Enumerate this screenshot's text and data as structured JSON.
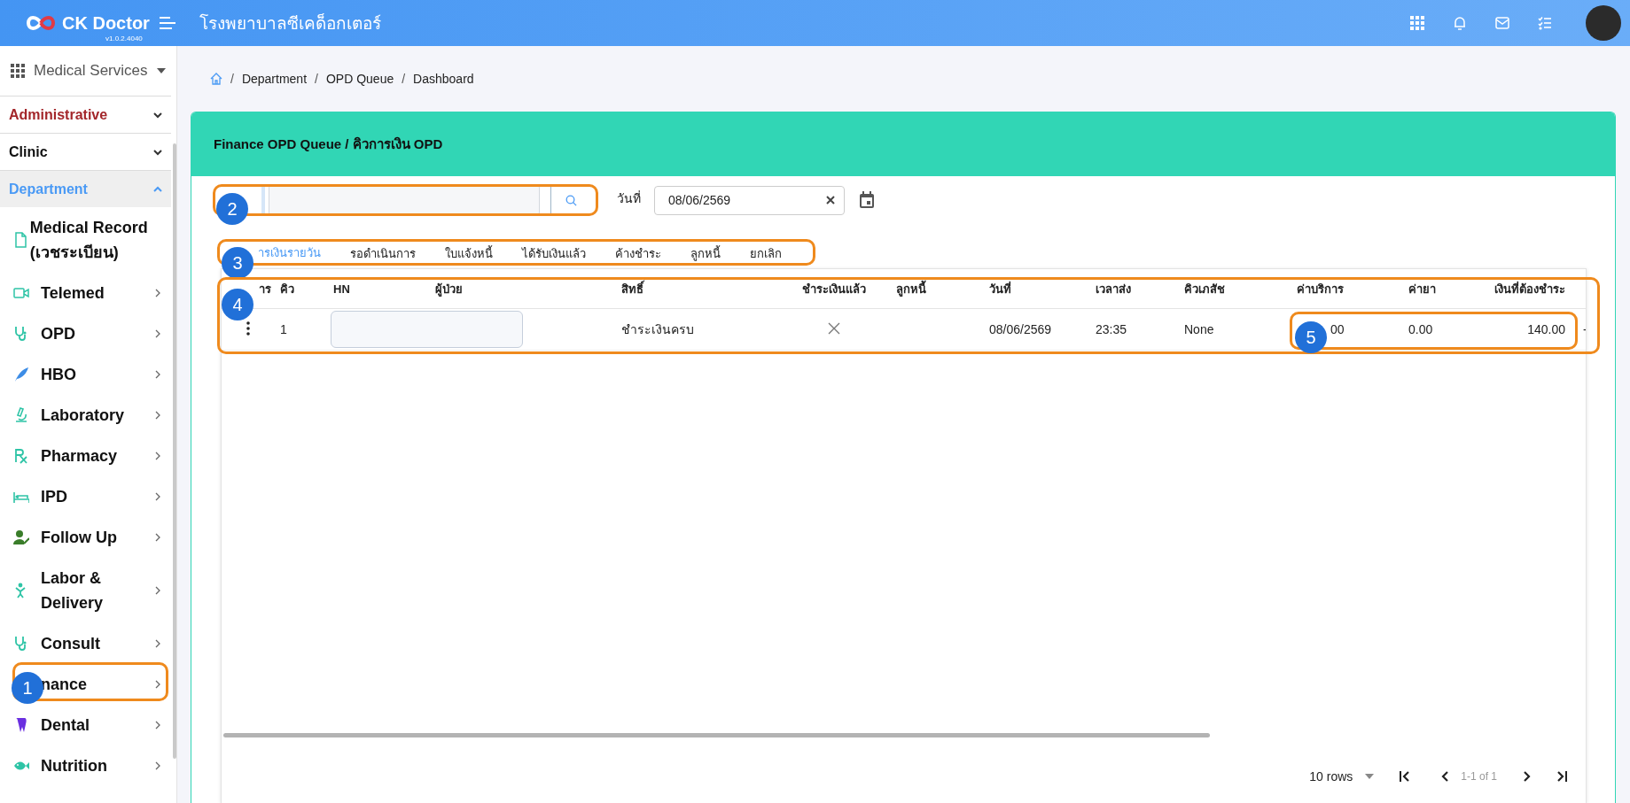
{
  "header": {
    "app_name": "CK Doctor",
    "version": "v1.0.2.4040",
    "hospital": "โรงพยาบาลซีเคด็อกเตอร์"
  },
  "sidebar": {
    "module": "Medical Services",
    "sections": [
      {
        "label": "Administrative",
        "expanded": false,
        "color": "#a3262a"
      },
      {
        "label": "Clinic",
        "expanded": false,
        "color": "#111111"
      },
      {
        "label": "Department",
        "expanded": true,
        "color": "#4a9af5"
      }
    ],
    "items": [
      {
        "label": "Medical Record (เวชระเบียน)"
      },
      {
        "label": "Telemed"
      },
      {
        "label": "OPD"
      },
      {
        "label": "HBO"
      },
      {
        "label": "Laboratory"
      },
      {
        "label": "Pharmacy"
      },
      {
        "label": "IPD"
      },
      {
        "label": "Follow Up"
      },
      {
        "label": "Labor & Delivery"
      },
      {
        "label": "Consult"
      },
      {
        "label": "nance"
      },
      {
        "label": "Dental"
      },
      {
        "label": "Nutrition"
      }
    ]
  },
  "breadcrumb": {
    "separator": "/",
    "items": [
      "Department",
      "OPD Queue",
      "Dashboard"
    ]
  },
  "card": {
    "title": "Finance OPD Queue / คิวการเงิน OPD"
  },
  "date_filter": {
    "label": "วันที่",
    "value": "08/06/2569"
  },
  "tabs": [
    {
      "label": "ารเงินรายวัน",
      "selected": true
    },
    {
      "label": "รอดำเนินการ",
      "selected": false
    },
    {
      "label": "ใบแจ้งหนี้",
      "selected": false
    },
    {
      "label": "ได้รับเงินแล้ว",
      "selected": false
    },
    {
      "label": "ค้างชำระ",
      "selected": false
    },
    {
      "label": "ลูกหนี้",
      "selected": false
    },
    {
      "label": "ยกเลิก",
      "selected": false
    }
  ],
  "table": {
    "columns": [
      "าร",
      "คิว",
      "HN",
      "ผู้ป่วย",
      "สิทธิ์",
      "ชำระเงินแล้ว",
      "ลูกหนี้",
      "วันที่",
      "เวลาส่ง",
      "คิวเภสัช",
      "ค่าบริการ",
      "ค่ายา",
      "เงินที่ต้องชำระ"
    ],
    "rows": [
      {
        "queue": "1",
        "right": "ชำระเงินครบ",
        "paid": false,
        "date": "08/06/2569",
        "sent_time": "23:35",
        "pharmacy_queue": "None",
        "service_fee": "00",
        "drug_fee": "0.00",
        "amount_due": "140.00",
        "column_14": "-"
      }
    ]
  },
  "pager": {
    "rows_per_page": "10 rows",
    "range": "1-1 of 1"
  },
  "annotations": [
    {
      "number": "1"
    },
    {
      "number": "2"
    },
    {
      "number": "3"
    },
    {
      "number": "4"
    },
    {
      "number": "5"
    }
  ]
}
